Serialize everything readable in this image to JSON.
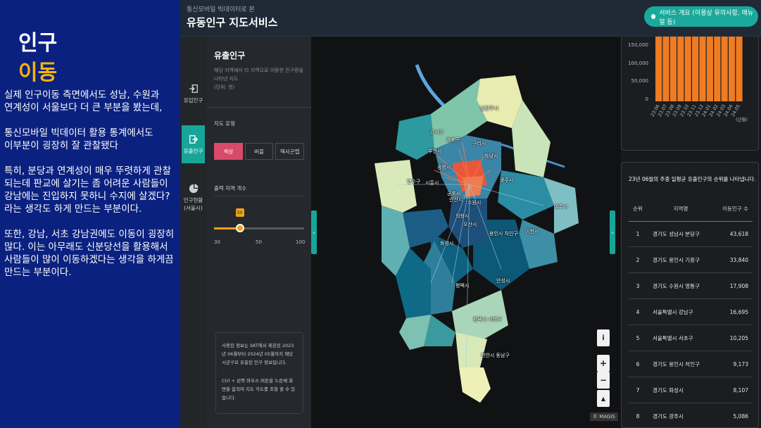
{
  "slide": {
    "title_line1": "인구",
    "title_line2": "이동",
    "paragraphs": "실제 인구이동 측면에서도 성남, 수원과\n연계성이 서울보다 더 큰 부분을 봤는데,\n\n통신모바일 빅데이터 활용 통계에서도\n이부분이 굉장히 잘 관찰됐다\n\n특히, 분당과 연계성이 매우 뚜렷하게 관찰\n되는데 판교에 살기는 좀 어려운 사람들이\n강남에는 진입하지 못하니 수지에 살겠다?\n라는 생각도 하게 만드는 부분이다.\n\n또한, 강남, 서초 강남권에도 이동이 굉장히\n많다. 이는 아무래도 신분당선을 활용해서\n사람들이 많이 이동하겠다는 생각을 하게끔\n만드는 부분이다."
  },
  "header": {
    "subtitle": "통신모바일 빅데이터로 본",
    "title": "유동인구 지도서비스",
    "service_button": "서비스 개요 (이용상 유의사항, 매뉴얼 등)"
  },
  "nav": {
    "items": [
      {
        "label": "유입인구",
        "icon": "login-icon"
      },
      {
        "label": "유출인구",
        "icon": "logout-icon"
      },
      {
        "label": "인구현황\n(서울시)",
        "icon": "pie-chart-icon"
      }
    ]
  },
  "panel": {
    "title": "유출인구",
    "description": "해당 지역에서 타 지역으로 이동한 인구량을\n나타낸 지도\n(단위: 명)",
    "map_type_label": "지도 유형",
    "map_types": [
      "색상",
      "버블",
      "헥사곤맵"
    ],
    "map_type_selected": "색상",
    "output_count_label": "출력 지역 개수",
    "slider": {
      "min": "30",
      "mid": "50",
      "max": "100",
      "value": 50,
      "tip": "50"
    },
    "info_1": "사용된 정보는 SKT에서 제공된 2023년 06월부터 2024년 05월까지 해당 시군구로 유출된 인구 정보입니다.",
    "info_2": "Ctrl + 왼쪽 마우스 버튼을 누른채 화면을 움직여 지도 각도를 조절 할 수 있습니다."
  },
  "map": {
    "labels": [
      "남양주시",
      "구리시",
      "하남시",
      "광주시",
      "여주시",
      "이천시",
      "용인시 처인구",
      "안성시",
      "평택시",
      "오산시",
      "화성시",
      "안산시",
      "수원시",
      "의왕시",
      "군포시",
      "광명시",
      "부천시",
      "시흥시",
      "연수구",
      "평택시 서북구",
      "천안시 동남구",
      "강서구",
      "마포구"
    ],
    "controls": {
      "info": "i",
      "zoom_in": "+",
      "zoom_out": "−",
      "compass": "▲"
    },
    "attribution": "© MAGIS"
  },
  "chart_data": {
    "type": "bar",
    "categories": [
      "23.06",
      "23.07",
      "23.08",
      "23.09",
      "23.10",
      "23.11",
      "23.12",
      "24.01",
      "24.02",
      "24.03",
      "24.04",
      "24.05"
    ],
    "series": [
      {
        "values": [
          170000,
          170000,
          170000,
          170000,
          170000,
          170000,
          170000,
          170000,
          170000,
          170000,
          170000,
          170000
        ]
      }
    ],
    "yticks": [
      "150,000",
      "100,000",
      "50,000",
      "0"
    ],
    "ylim": [
      0,
      170000
    ],
    "xlabel": "(년월)",
    "color": "#ef7b22"
  },
  "ranking": {
    "caption": "23년 06월의 주중 일평균 유출인구의 순위를 나타냅니다.",
    "headers": [
      "순위",
      "지역명",
      "이동인구 수"
    ],
    "rows": [
      [
        "1",
        "경기도 성남시 분당구",
        "43,618"
      ],
      [
        "2",
        "경기도 용인시 기흥구",
        "33,840"
      ],
      [
        "3",
        "경기도 수원시 영통구",
        "17,908"
      ],
      [
        "4",
        "서울특별시 강남구",
        "16,695"
      ],
      [
        "5",
        "서울특별시 서초구",
        "10,205"
      ],
      [
        "6",
        "경기도 용인시 처인구",
        "9,173"
      ],
      [
        "7",
        "경기도 화성시",
        "8,107"
      ],
      [
        "8",
        "경기도 광주시",
        "5,086"
      ]
    ]
  }
}
